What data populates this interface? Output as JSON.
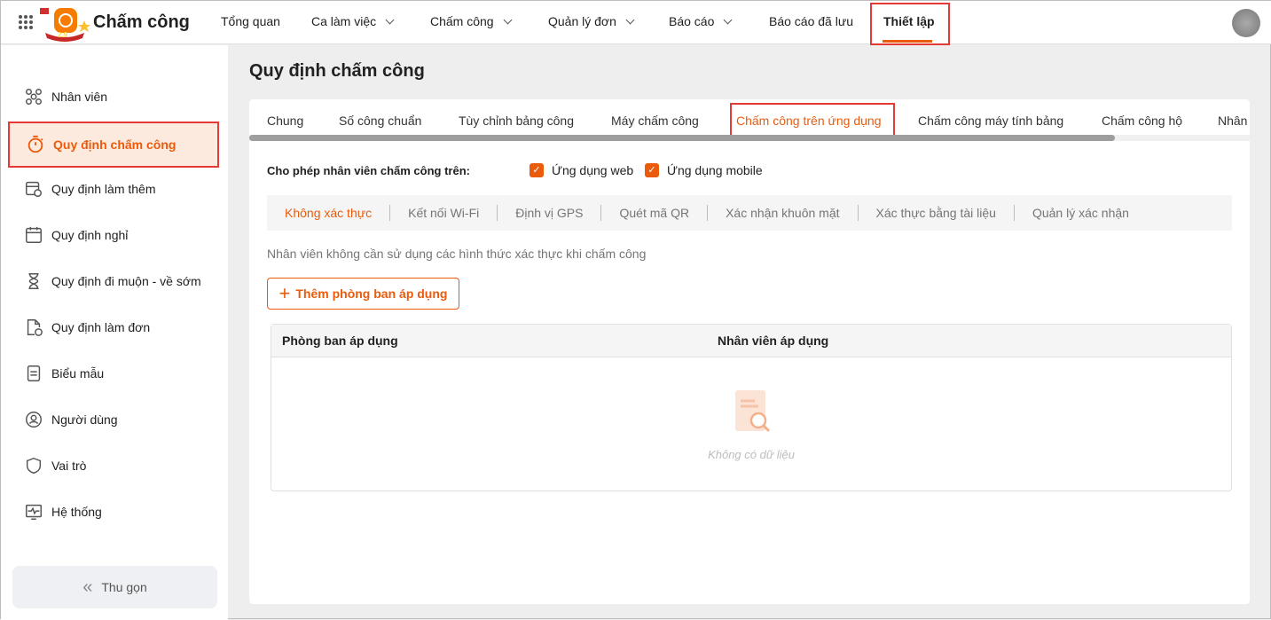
{
  "header": {
    "brand": "Chấm công",
    "nav": [
      {
        "label": "Tổng quan",
        "dropdown": false
      },
      {
        "label": "Ca làm việc",
        "dropdown": true
      },
      {
        "label": "Chấm công",
        "dropdown": true
      },
      {
        "label": "Quản lý đơn",
        "dropdown": true
      },
      {
        "label": "Báo cáo",
        "dropdown": true
      },
      {
        "label": "Báo cáo đã lưu",
        "dropdown": false
      },
      {
        "label": "Thiết lập",
        "dropdown": false,
        "active": true
      }
    ]
  },
  "sidebar": {
    "items": [
      {
        "label": "Nhân viên",
        "icon": "people-icon"
      },
      {
        "label": "Quy định chấm công",
        "icon": "stopwatch-icon",
        "active": true
      },
      {
        "label": "Quy định làm thêm",
        "icon": "calendar-clock-icon"
      },
      {
        "label": "Quy định nghỉ",
        "icon": "calendar-icon"
      },
      {
        "label": "Quy định đi muộn - về sớm",
        "icon": "hourglass-icon"
      },
      {
        "label": "Quy định làm đơn",
        "icon": "document-clock-icon"
      },
      {
        "label": "Biểu mẫu",
        "icon": "form-icon"
      },
      {
        "label": "Người dùng",
        "icon": "user-icon"
      },
      {
        "label": "Vai trò",
        "icon": "shield-icon"
      },
      {
        "label": "Hệ thống",
        "icon": "monitor-icon"
      }
    ],
    "collapse": "Thu gọn"
  },
  "main": {
    "title": "Quy định chấm công",
    "tabs": [
      "Chung",
      "Số công chuẩn",
      "Tùy chỉnh bảng công",
      "Máy chấm công",
      "Chấm công trên ứng dụng",
      "Chấm công máy tính bảng",
      "Chấm công hộ",
      "Nhân"
    ],
    "active_tab": 4,
    "permission_label": "Cho phép nhân viên chấm công trên:",
    "checkboxes": [
      {
        "label": "Ứng dụng web",
        "checked": true
      },
      {
        "label": "Ứng dụng mobile",
        "checked": true
      }
    ],
    "subtabs": [
      "Không xác thực",
      "Kết nối Wi-Fi",
      "Định vị GPS",
      "Quét mã QR",
      "Xác nhận khuôn mặt",
      "Xác thực bằng tài liệu",
      "Quản lý xác nhận"
    ],
    "description": "Nhân viên không cần sử dụng các hình thức xác thực khi chấm công",
    "add_button": "Thêm phòng ban áp dụng",
    "table": {
      "columns": [
        "Phòng ban áp dụng",
        "Nhân viên áp dụng"
      ],
      "rows": [],
      "empty": "Không có dữ liệu"
    }
  },
  "colors": {
    "accent": "#ea5b0c",
    "highlight_box": "#e53935"
  }
}
